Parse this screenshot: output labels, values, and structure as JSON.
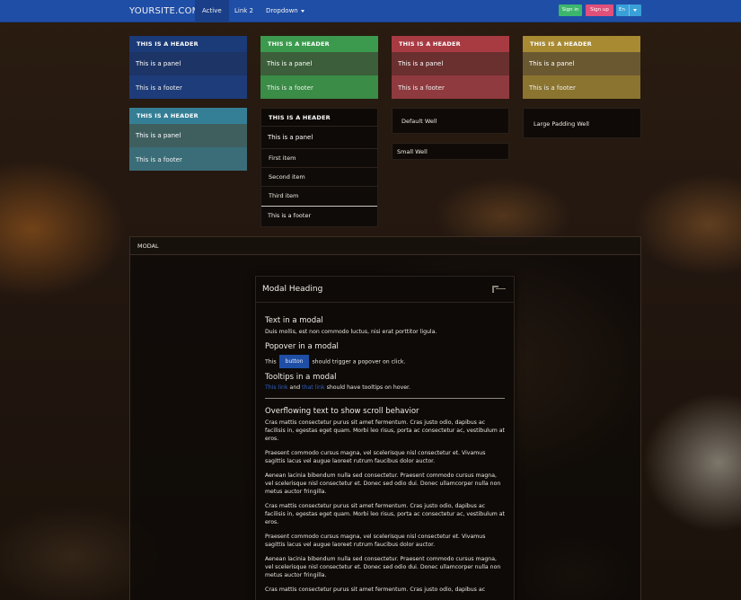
{
  "navbar": {
    "brand": "YOURSITE.COM",
    "items": [
      {
        "label": "Active"
      },
      {
        "label": "Link 2"
      },
      {
        "label": "Dropdown"
      }
    ],
    "buttons": [
      {
        "label": "Sign in",
        "color": "#3cb66c"
      },
      {
        "label": "Sign up",
        "color": "#e0507a"
      },
      {
        "label": "En",
        "color": "#3aa0d8"
      }
    ]
  },
  "panels": {
    "blue": {
      "header": "THIS IS A HEADER",
      "body": "This is a panel",
      "footer": "This is a footer"
    },
    "green": {
      "header": "THIS IS A HEADER",
      "body": "This is a panel",
      "footer": "This is a footer"
    },
    "red": {
      "header": "THIS IS A HEADER",
      "body": "This is a panel",
      "footer": "This is a footer"
    },
    "gold": {
      "header": "THIS IS A HEADER",
      "body": "This is a panel",
      "footer": "This is a footer"
    },
    "teal": {
      "header": "THIS IS A HEADER",
      "body": "This is a panel",
      "footer": "This is a footer"
    },
    "list": {
      "header": "THIS IS A HEADER",
      "body": "This is a panel",
      "items": [
        "First item",
        "Second item",
        "Third item"
      ],
      "footer": "This is a footer"
    }
  },
  "wells": {
    "default": "Default Well",
    "small": "Small Well",
    "large": "Large Padding Well"
  },
  "modal_section": {
    "title": "MODAL"
  },
  "modal": {
    "heading": "Modal Heading",
    "text_title": "Text in a modal",
    "text_body": "Duis mollis, est non commodo luctus, nisi erat porttitor ligula.",
    "popover_title": "Popover in a modal",
    "popover_pre": "This",
    "popover_button": "button",
    "popover_post": "should trigger a popover on click.",
    "tooltips_title": "Tooltips in a modal",
    "tooltip_link1": "This link",
    "tooltip_and": "and",
    "tooltip_link2": "that link",
    "tooltip_post": "should have tooltips on hover.",
    "overflow_title": "Overflowing text to show scroll behavior",
    "paragraphs": [
      "Cras mattis consectetur purus sit amet fermentum. Cras justo odio, dapibus ac facilisis in, egestas eget quam. Morbi leo risus, porta ac consectetur ac, vestibulum at eros.",
      "Praesent commodo cursus magna, vel scelerisque nisl consectetur et. Vivamus sagittis lacus vel augue laoreet rutrum faucibus dolor auctor.",
      "Aenean lacinia bibendum nulla sed consectetur. Praesent commodo cursus magna, vel scelerisque nisl consectetur et. Donec sed odio dui. Donec ullamcorper nulla non metus auctor fringilla.",
      "Cras mattis consectetur purus sit amet fermentum. Cras justo odio, dapibus ac facilisis in, egestas eget quam. Morbi leo risus, porta ac consectetur ac, vestibulum at eros.",
      "Praesent commodo cursus magna, vel scelerisque nisl consectetur et. Vivamus sagittis lacus vel augue laoreet rutrum faucibus dolor auctor.",
      "Aenean lacinia bibendum nulla sed consectetur. Praesent commodo cursus magna, vel scelerisque nisl consectetur et. Donec sed odio dui. Donec ullamcorper nulla non metus auctor fringilla.",
      "Cras mattis consectetur purus sit amet fermentum. Cras justo odio, dapibus ac"
    ]
  }
}
